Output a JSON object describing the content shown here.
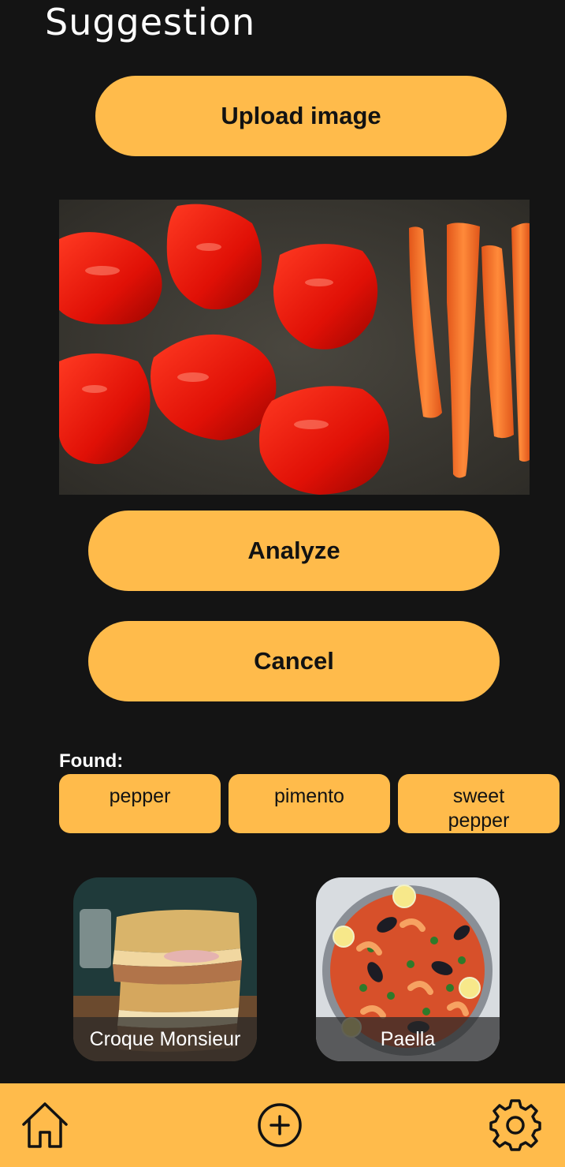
{
  "header": {
    "title": "Suggestion"
  },
  "actions": {
    "upload_label": "Upload image",
    "analyze_label": "Analyze",
    "cancel_label": "Cancel"
  },
  "found": {
    "label": "Found:",
    "items": [
      "pepper",
      "pimento",
      "sweet\npepper"
    ]
  },
  "recipes": [
    {
      "name": "Croque Monsieur"
    },
    {
      "name": "Paella"
    }
  ],
  "nav": {
    "items": [
      {
        "icon": "home-icon"
      },
      {
        "icon": "plus-circle-icon"
      },
      {
        "icon": "gear-icon"
      }
    ]
  },
  "colors": {
    "background": "#141414",
    "accent": "#ffbb4b",
    "text_on_accent": "#121212"
  }
}
